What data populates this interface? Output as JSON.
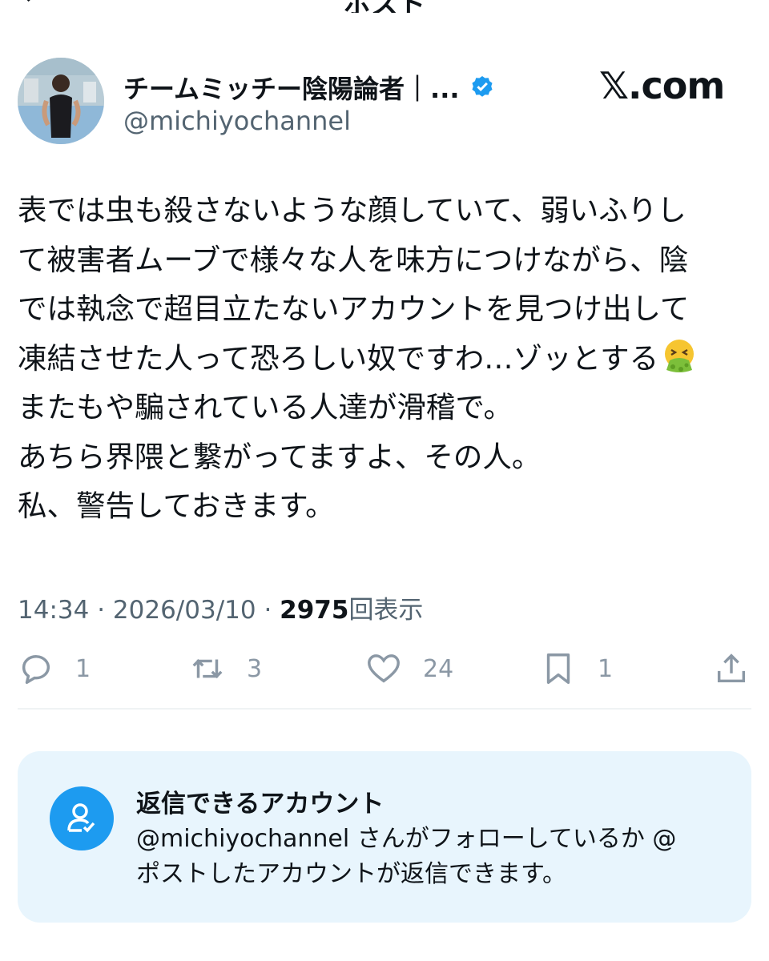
{
  "topbar": {
    "title": "ポスト"
  },
  "author": {
    "display_name": "チームミッチー陰陽論者｜...",
    "handle": "@michiyochannel",
    "verified": true
  },
  "source_logo": "𝕏.com",
  "post": {
    "lines": [
      "表では虫も殺さないような顔していて、弱いふりし",
      "て被害者ムーブで様々な人を味方につけながら、陰",
      "では執念で超目立たないアカウントを見つけ出して",
      "凍結させた人って恐ろしい奴ですわ…ゾッとする",
      "またもや騙されている人達が滑稽で。",
      "あちら界隈と繋がってますよ、その人。",
      "私、警告しておきます。"
    ],
    "emoji": "vomiting-face"
  },
  "meta": {
    "time": "14:34",
    "sep1": " · ",
    "date": "2026/03/10",
    "sep2": " · ",
    "views_count": "2975",
    "views_label": "回表示"
  },
  "actions": {
    "reply_count": "1",
    "repost_count": "3",
    "like_count": "24",
    "bookmark_count": "1"
  },
  "reply_restriction": {
    "title": "返信できるアカウント",
    "line1": "@michiyochannel さんがフォローしているか @",
    "line2": "ポストしたアカウントが返信できます。"
  },
  "colors": {
    "text": "#0f1419",
    "secondary": "#536471",
    "icon_gray": "#8b98a5",
    "accent": "#1d9bf0",
    "info_bg": "#e8f5fd"
  }
}
